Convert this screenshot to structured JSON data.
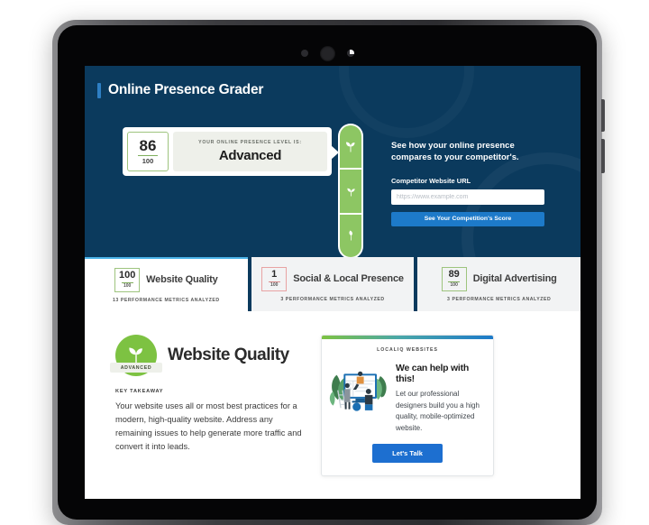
{
  "header": {
    "app_title": "Online Presence Grader",
    "accent_color": "#2e7fc4",
    "background_color": "#0b3a5d"
  },
  "score_banner": {
    "score": "86",
    "denominator": "100",
    "eyebrow": "YOUR ONLINE PRESENCE LEVEL IS:",
    "level": "Advanced"
  },
  "level_ladder": {
    "segments": [
      {
        "name": "advanced",
        "icon": "sprout-icon"
      },
      {
        "name": "intermediate",
        "icon": "seedling-icon"
      },
      {
        "name": "beginner",
        "icon": "leaf-icon"
      }
    ],
    "color": "#8dc663"
  },
  "competitor": {
    "heading": "See how your online presence compares to your competitor's.",
    "field_label": "Competitor Website URL",
    "url_value": "",
    "url_placeholder": "https://www.example.com",
    "submit_label": "See Your Competition's Score",
    "submit_color": "#1d7ac9"
  },
  "categories": [
    {
      "score": "100",
      "denominator": "100",
      "label": "Website Quality",
      "metrics_text": "13 PERFORMANCE METRICS ANALYZED",
      "active": true,
      "tone": "good"
    },
    {
      "score": "1",
      "denominator": "100",
      "label": "Social & Local Presence",
      "metrics_text": "3 PERFORMANCE METRICS ANALYZED",
      "active": false,
      "tone": "poor"
    },
    {
      "score": "89",
      "denominator": "100",
      "label": "Digital Advertising",
      "metrics_text": "3 PERFORMANCE METRICS ANALYZED",
      "active": false,
      "tone": "good"
    }
  ],
  "detail": {
    "badge_label": "ADVANCED",
    "title": "Website Quality",
    "takeaway_label": "KEY TAKEAWAY",
    "takeaway_body": "Your website uses all or most best practices for a modern, high-quality website. Address any remaining issues to help generate more traffic and convert it into leads."
  },
  "promo": {
    "brand": "LOCALIQ WEBSITES",
    "heading": "We can help with this!",
    "copy": "Let our professional designers build you a high quality, mobile-optimized website.",
    "cta_label": "Let's Talk",
    "cta_color": "#1d6fd0"
  }
}
